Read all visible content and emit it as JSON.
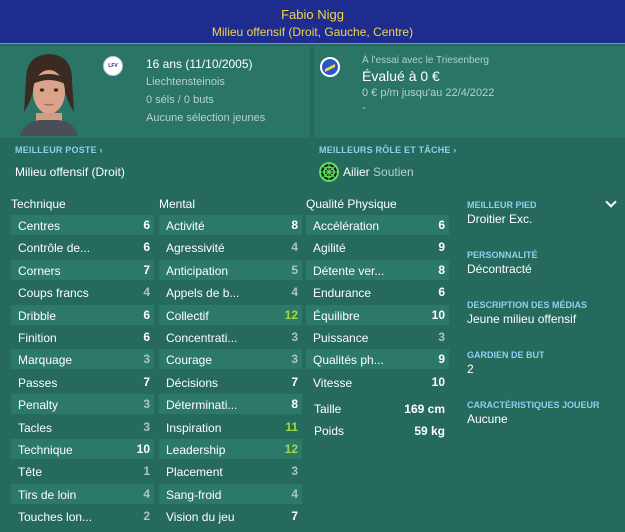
{
  "header": {
    "name": "Fabio Nigg",
    "position": "Milieu offensif (Droit, Gauche, Centre)"
  },
  "profile": {
    "age": "16 ans (11/10/2005)",
    "nationality": "Liechtensteinois",
    "caps": "0 séls / 0 buts",
    "youth": "Aucune sélection jeunes",
    "badge_text": "LFV"
  },
  "loan": {
    "status": "À l'essai avec le Triesenberg",
    "value": "Évalué à 0 €",
    "wage": "0 € p/m jusqu'au 22/4/2022",
    "extra": "-"
  },
  "best_position": {
    "title": "MEILLEUR POSTE",
    "value": "Milieu offensif (Droit)"
  },
  "best_role": {
    "title": "MEILLEURS RÔLE ET TÂCHE",
    "role": "Ailier",
    "duty": "Soutien",
    "role_color": "#5ce35c"
  },
  "columns": {
    "technique": "Technique",
    "mental": "Mental",
    "physical": "Qualité Physique"
  },
  "technique": [
    {
      "label": "Centres",
      "value": "6"
    },
    {
      "label": "Contrôle de...",
      "value": "6"
    },
    {
      "label": "Corners",
      "value": "7"
    },
    {
      "label": "Coups francs",
      "value": "4"
    },
    {
      "label": "Dribble",
      "value": "6"
    },
    {
      "label": "Finition",
      "value": "6"
    },
    {
      "label": "Marquage",
      "value": "3"
    },
    {
      "label": "Passes",
      "value": "7"
    },
    {
      "label": "Penalty",
      "value": "3"
    },
    {
      "label": "Tacles",
      "value": "3"
    },
    {
      "label": "Technique",
      "value": "10"
    },
    {
      "label": "Tête",
      "value": "1"
    },
    {
      "label": "Tirs de loin",
      "value": "4"
    },
    {
      "label": "Touches lon...",
      "value": "2"
    }
  ],
  "mental": [
    {
      "label": "Activité",
      "value": "8"
    },
    {
      "label": "Agressivité",
      "value": "4"
    },
    {
      "label": "Anticipation",
      "value": "5"
    },
    {
      "label": "Appels de b...",
      "value": "4"
    },
    {
      "label": "Collectif",
      "value": "12"
    },
    {
      "label": "Concentrati...",
      "value": "3"
    },
    {
      "label": "Courage",
      "value": "3"
    },
    {
      "label": "Décisions",
      "value": "7"
    },
    {
      "label": "Déterminati...",
      "value": "8"
    },
    {
      "label": "Inspiration",
      "value": "11"
    },
    {
      "label": "Leadership",
      "value": "12"
    },
    {
      "label": "Placement",
      "value": "3"
    },
    {
      "label": "Sang-froid",
      "value": "4"
    },
    {
      "label": "Vision du jeu",
      "value": "7"
    }
  ],
  "physical": [
    {
      "label": "Accélération",
      "value": "6"
    },
    {
      "label": "Agilité",
      "value": "9"
    },
    {
      "label": "Détente ver...",
      "value": "8"
    },
    {
      "label": "Endurance",
      "value": "6"
    },
    {
      "label": "Équilibre",
      "value": "10"
    },
    {
      "label": "Puissance",
      "value": "3"
    },
    {
      "label": "Qualités ph...",
      "value": "9"
    },
    {
      "label": "Vitesse",
      "value": "10"
    }
  ],
  "physical_extra": {
    "height_label": "Taille",
    "height": "169 cm",
    "weight_label": "Poids",
    "weight": "59 kg"
  },
  "side": {
    "foot_title": "MEILLEUR PIED",
    "foot": "Droitier Exc.",
    "personality_title": "PERSONNALITÉ",
    "personality": "Décontracté",
    "media_title": "DESCRIPTION DES MÉDIAS",
    "media": "Jeune milieu offensif",
    "gk_title": "GARDIEN DE BUT",
    "gk": "2",
    "traits_title": "CARACTÉRISTIQUES JOUEUR",
    "traits": "Aucune"
  },
  "colors": {
    "header_bg": "#1e2b8f",
    "header_text": "#f2d64a",
    "panel_bg": "#256a5c",
    "section_title": "#8fd0ee",
    "val_high": "#9bd94a",
    "val_mid": "#ffffff",
    "val_low": "#a9c6bd"
  }
}
